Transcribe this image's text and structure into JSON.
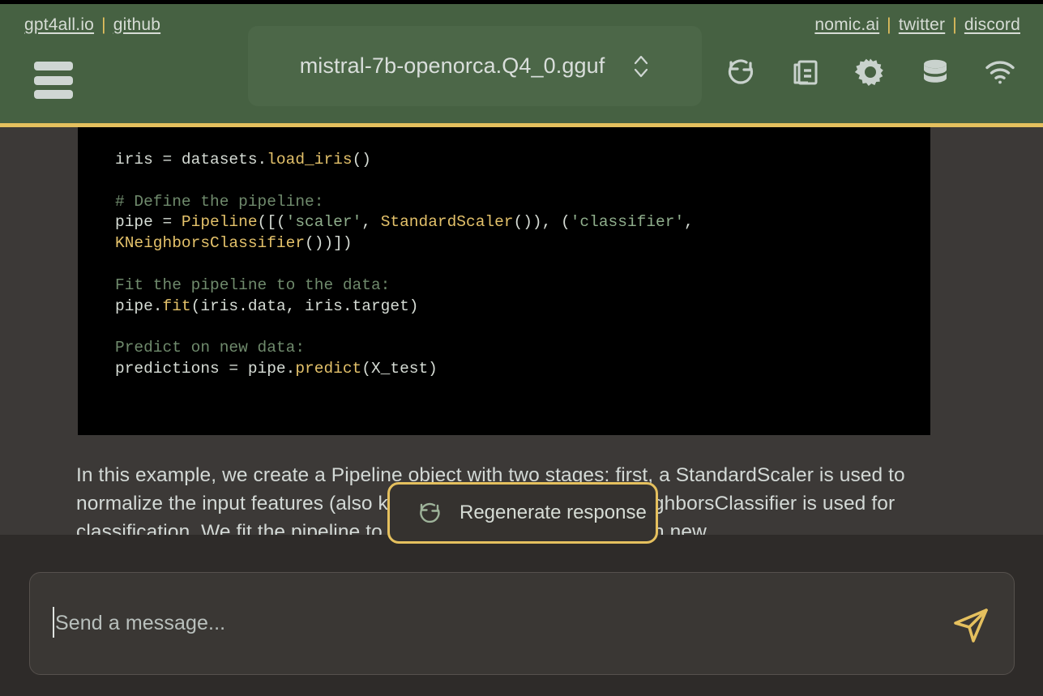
{
  "header": {
    "left_links": [
      {
        "label": "gpt4all.io",
        "name": "link-gpt4all-io"
      },
      {
        "label": "github",
        "name": "link-github"
      }
    ],
    "right_links": [
      {
        "label": "nomic.ai",
        "name": "link-nomic-ai"
      },
      {
        "label": "twitter",
        "name": "link-twitter"
      },
      {
        "label": "discord",
        "name": "link-discord"
      }
    ],
    "separator": "|",
    "menu_icon": "hamburger-menu-icon",
    "model_selector": {
      "value": "mistral-7b-openorca.Q4_0.gguf",
      "chevron_icon": "chevron-up-down-icon"
    },
    "icons": [
      {
        "name": "regenerate-icon",
        "label": "Regenerate"
      },
      {
        "name": "copy-icon",
        "label": "Copy"
      },
      {
        "name": "gear-icon",
        "label": "Settings"
      },
      {
        "name": "database-icon",
        "label": "LocalDocs"
      },
      {
        "name": "network-icon",
        "label": "Network"
      }
    ]
  },
  "conversation": {
    "code_lines": [
      {
        "type": "code",
        "segments": [
          {
            "cls": "pln",
            "t": "iris = datasets."
          },
          {
            "cls": "fn",
            "t": "load_iris"
          },
          {
            "cls": "pln",
            "t": "()"
          }
        ]
      },
      {
        "type": "blank"
      },
      {
        "type": "code",
        "segments": [
          {
            "cls": "cmt",
            "t": "# Define the pipeline:"
          }
        ]
      },
      {
        "type": "code",
        "segments": [
          {
            "cls": "pln",
            "t": "pipe = "
          },
          {
            "cls": "fn",
            "t": "Pipeline"
          },
          {
            "cls": "pln",
            "t": "([("
          },
          {
            "cls": "str",
            "t": "'scaler'"
          },
          {
            "cls": "pln",
            "t": ", "
          },
          {
            "cls": "fn",
            "t": "StandardScaler"
          },
          {
            "cls": "pln",
            "t": "()), ("
          },
          {
            "cls": "str",
            "t": "'classifier'"
          },
          {
            "cls": "pln",
            "t": ","
          }
        ]
      },
      {
        "type": "code",
        "segments": [
          {
            "cls": "fn",
            "t": "KNeighborsClassifier"
          },
          {
            "cls": "pln",
            "t": "())])"
          }
        ]
      },
      {
        "type": "blank"
      },
      {
        "type": "code",
        "segments": [
          {
            "cls": "cmt",
            "t": "Fit the pipeline to the data:"
          }
        ]
      },
      {
        "type": "code",
        "segments": [
          {
            "cls": "pln",
            "t": "pipe."
          },
          {
            "cls": "fn",
            "t": "fit"
          },
          {
            "cls": "pln",
            "t": "(iris.data, iris.target)"
          }
        ]
      },
      {
        "type": "blank"
      },
      {
        "type": "code",
        "segments": [
          {
            "cls": "cmt",
            "t": "Predict on new data:"
          }
        ]
      },
      {
        "type": "code",
        "segments": [
          {
            "cls": "pln",
            "t": "predictions = pipe."
          },
          {
            "cls": "fn",
            "t": "predict"
          },
          {
            "cls": "pln",
            "t": "(X_test)"
          }
        ]
      }
    ],
    "answer_paragraph": "In this example, we create a Pipeline object with two stages: first, a StandardScaler is used to normalize the input features (also known as scaling), then a KNeighborsClassifier is used for classification. We fit the pipeline to the training data and predict on new",
    "regenerate_button": {
      "label": "Regenerate response",
      "icon": "regenerate-icon"
    }
  },
  "input_bar": {
    "placeholder": "Send a message...",
    "value": "",
    "send_icon": "send-paper-plane-icon"
  },
  "colors": {
    "header_green": "#466142",
    "accent_gold": "#e5c05e",
    "body_background": "#3c3937",
    "bottom_bar": "#2e2b29",
    "code_background": "#000000",
    "text_light": "#d6dcd5"
  }
}
